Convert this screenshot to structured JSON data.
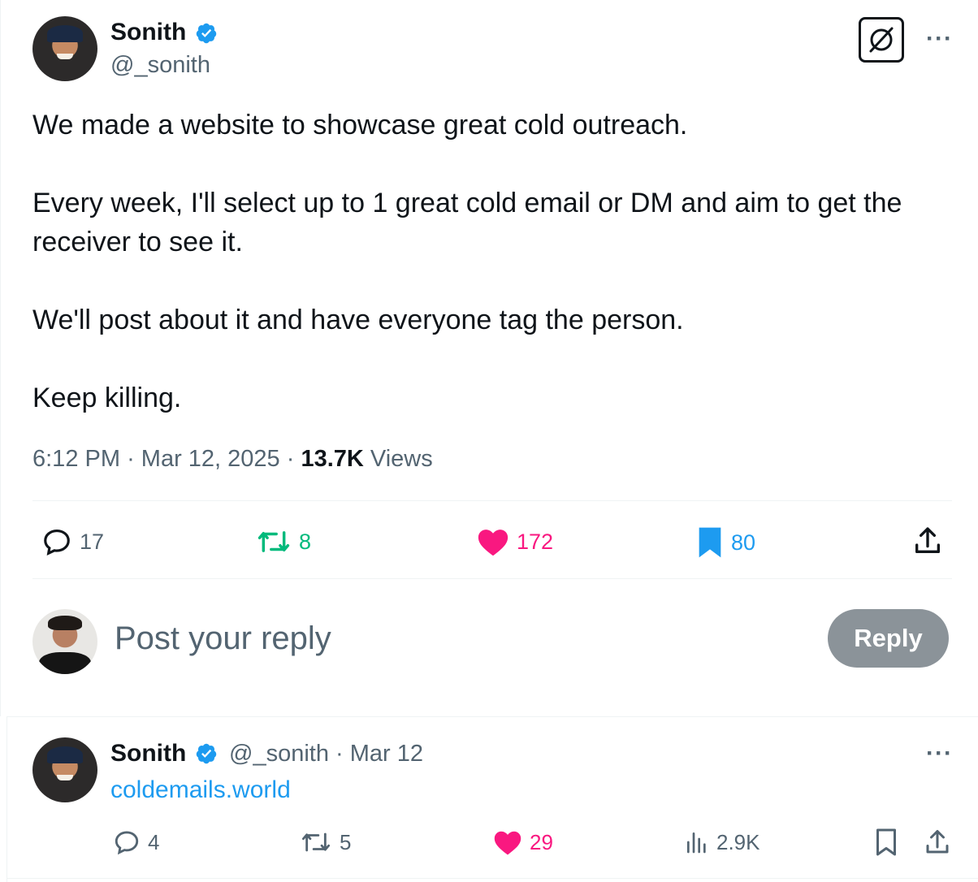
{
  "main_post": {
    "author_name": "Sonith",
    "author_handle": "@_sonith",
    "paragraphs": [
      "We made a website to showcase great cold outreach.",
      "",
      "Every week, I'll select up to 1 great cold email or DM and aim to get the receiver to see it.",
      "",
      "We'll post about it and have everyone tag the person.",
      "",
      "Keep killing."
    ],
    "time": "6:12 PM",
    "date": "Mar 12, 2025",
    "views_count": "13.7K",
    "views_label": "Views",
    "actions": {
      "replies": "17",
      "reposts": "8",
      "likes": "172",
      "bookmarks": "80"
    }
  },
  "composer": {
    "placeholder": "Post your reply",
    "button_label": "Reply"
  },
  "reply_post": {
    "author_name": "Sonith",
    "author_handle": "@_sonith",
    "date": "Mar 12",
    "link_text": "coldemails.world",
    "actions": {
      "replies": "4",
      "reposts": "5",
      "likes": "29",
      "views": "2.9K"
    }
  },
  "icons": {
    "verified": "verified-badge-icon",
    "grok": "grok-icon",
    "more": "more-icon",
    "reply": "reply-icon",
    "repost": "repost-icon",
    "like": "heart-icon",
    "bookmark": "bookmark-icon",
    "share": "share-icon",
    "views": "views-icon"
  },
  "colors": {
    "text": "#0f1419",
    "secondary": "#536471",
    "blue": "#1d9bf0",
    "repost_green": "#00ba7c",
    "like_pink": "#f91880",
    "reply_button": "#8b9399"
  }
}
